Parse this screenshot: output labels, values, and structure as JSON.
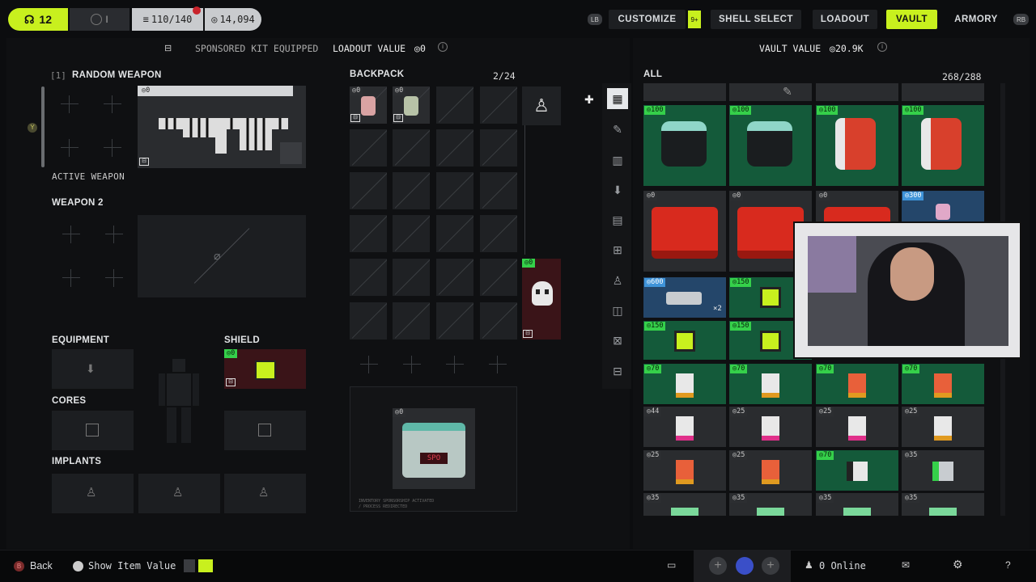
{
  "topbar": {
    "level": "12",
    "rank": "I",
    "capacity": "110/140",
    "credits": "14,094",
    "lb": "LB",
    "rb": "RB",
    "customize_badge": "9+",
    "tabs": [
      "CUSTOMIZE",
      "SHELL SELECT",
      "LOADOUT",
      "VAULT",
      "ARMORY"
    ],
    "active_tab": "VAULT"
  },
  "subheader": {
    "sponsored": "SPONSORED KIT EQUIPPED",
    "loadout_value_label": "LOADOUT VALUE",
    "loadout_value": "0",
    "vault_value_label": "VAULT VALUE",
    "vault_value": "20.9K"
  },
  "loadout": {
    "slot_index": "[1]",
    "weapon1_title": "RANDOM WEAPON",
    "weapon1_price": "0",
    "active_weapon": "ACTIVE WEAPON",
    "weapon2_title": "WEAPON 2",
    "equipment": "EQUIPMENT",
    "shield": "SHIELD",
    "shield_price": "0",
    "cores": "CORES",
    "implants": "IMPLANTS",
    "y_button": "Y"
  },
  "backpack": {
    "title": "BACKPACK",
    "count": "2/24",
    "item1_price": "0",
    "item2_price": "0",
    "side_item_price": "0",
    "kit_price": "0",
    "kit_label": "SPO",
    "kit_caption1": "INVENTORY SPONSORSHIP ACTIVATED",
    "kit_caption2": "/ PROCESS REDIRECTED"
  },
  "vault": {
    "title": "ALL",
    "count": "268/288",
    "rows": [
      [
        {
          "p": "100",
          "c": "green"
        },
        {
          "p": "100",
          "c": "green"
        },
        {
          "p": "100",
          "c": "green"
        },
        {
          "p": "100",
          "c": "green"
        }
      ],
      [
        {
          "p": "0",
          "c": "gray"
        },
        {
          "p": "0",
          "c": "gray"
        },
        {
          "p": "0",
          "c": "gray"
        },
        {
          "p": "300",
          "c": "blue"
        }
      ],
      [
        {
          "p": "600",
          "c": "blue"
        },
        {
          "p": "150",
          "c": "green"
        }
      ],
      [
        {
          "p": "150",
          "c": "green"
        },
        {
          "p": "150",
          "c": "green"
        }
      ],
      [
        {
          "p": "70",
          "c": "green"
        },
        {
          "p": "70",
          "c": "green"
        },
        {
          "p": "70",
          "c": "green"
        },
        {
          "p": "70",
          "c": "green"
        }
      ],
      [
        {
          "p": "44",
          "c": "gray"
        },
        {
          "p": "25",
          "c": "gray"
        },
        {
          "p": "25",
          "c": "gray"
        },
        {
          "p": "25",
          "c": "gray"
        }
      ],
      [
        {
          "p": "25",
          "c": "gray"
        },
        {
          "p": "25",
          "c": "gray"
        },
        {
          "p": "70",
          "c": "green"
        },
        {
          "p": "35",
          "c": "gray"
        }
      ],
      [
        {
          "p": "35",
          "c": "gray"
        },
        {
          "p": "35",
          "c": "gray"
        },
        {
          "p": "35",
          "c": "gray"
        },
        {
          "p": "35",
          "c": "gray"
        }
      ]
    ],
    "stack_count": "×2"
  },
  "footer": {
    "back_btn": "B",
    "back": "Back",
    "show_value": "Show Item Value",
    "online": "0 Online"
  },
  "colors": {
    "accent": "#c8f01e",
    "green_rarity": "#145a3a",
    "blue_rarity": "#24466a"
  }
}
